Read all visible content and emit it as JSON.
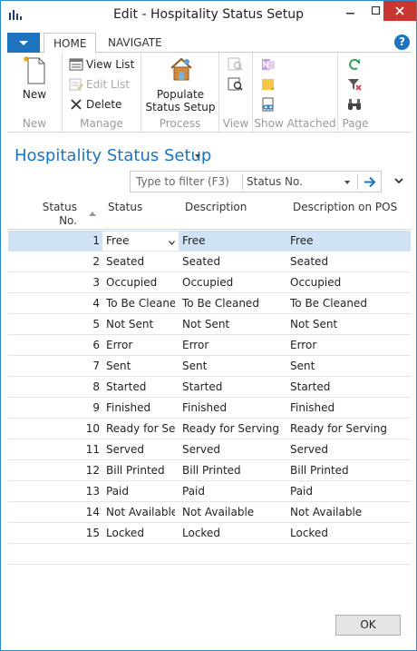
{
  "window": {
    "title": "Edit - Hospitality Status Setup"
  },
  "ribbon": {
    "tabs": [
      "HOME",
      "NAVIGATE"
    ],
    "groups": {
      "new": {
        "label": "New",
        "new_button": "New"
      },
      "manage": {
        "label": "Manage",
        "view_list": "View List",
        "edit_list": "Edit List",
        "delete": "Delete"
      },
      "process": {
        "label": "Process",
        "populate_line1": "Populate",
        "populate_line2": "Status Setup"
      },
      "view": {
        "label": "View"
      },
      "show_attached": {
        "label": "Show Attached"
      },
      "page": {
        "label": "Page"
      }
    }
  },
  "page": {
    "title": "Hospitality Status Setup"
  },
  "filter": {
    "placeholder": "Type to filter (F3)",
    "field": "Status No."
  },
  "grid": {
    "columns": {
      "status_no_line1": "Status",
      "status_no_line2": "No.",
      "status": "Status",
      "description": "Description",
      "description_pos": "Description on POS"
    },
    "rows": [
      {
        "no": "1",
        "status": "Free",
        "description": "Free",
        "pos": "Free"
      },
      {
        "no": "2",
        "status": "Seated",
        "description": "Seated",
        "pos": "Seated"
      },
      {
        "no": "3",
        "status": "Occupied",
        "description": "Occupied",
        "pos": "Occupied"
      },
      {
        "no": "4",
        "status": "To Be Cleaned",
        "description": "To Be Cleaned",
        "pos": "To Be Cleaned"
      },
      {
        "no": "5",
        "status": "Not Sent",
        "description": "Not Sent",
        "pos": "Not Sent"
      },
      {
        "no": "6",
        "status": "Error",
        "description": "Error",
        "pos": "Error"
      },
      {
        "no": "7",
        "status": "Sent",
        "description": "Sent",
        "pos": "Sent"
      },
      {
        "no": "8",
        "status": "Started",
        "description": "Started",
        "pos": "Started"
      },
      {
        "no": "9",
        "status": "Finished",
        "description": "Finished",
        "pos": "Finished"
      },
      {
        "no": "10",
        "status": "Ready for Se...",
        "description": "Ready for Serving",
        "pos": "Ready for Serving"
      },
      {
        "no": "11",
        "status": "Served",
        "description": "Served",
        "pos": "Served"
      },
      {
        "no": "12",
        "status": "Bill Printed",
        "description": "Bill Printed",
        "pos": "Bill Printed"
      },
      {
        "no": "13",
        "status": "Paid",
        "description": "Paid",
        "pos": "Paid"
      },
      {
        "no": "14",
        "status": "Not Available",
        "description": "Not Available",
        "pos": "Not Available"
      },
      {
        "no": "15",
        "status": "Locked",
        "description": "Locked",
        "pos": "Locked"
      }
    ]
  },
  "footer": {
    "ok": "OK"
  },
  "colors": {
    "accent": "#1e73be",
    "close": "#c7372f",
    "selected_row": "#cfe3f5"
  }
}
